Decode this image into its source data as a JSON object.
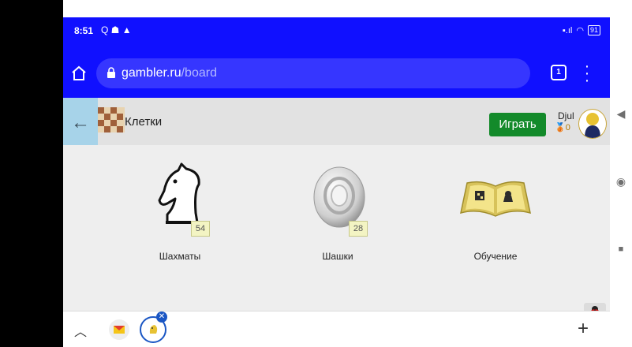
{
  "status_bar": {
    "time": "8:51",
    "left_icons": "Q ☗ ▲",
    "battery": "91"
  },
  "browser": {
    "url_domain": "gambler.ru",
    "url_path": "/board",
    "tab_count": "1"
  },
  "header": {
    "site_name": "Клетки",
    "play_label": "Играть",
    "user_name": "Djul",
    "user_score": "0"
  },
  "games": [
    {
      "label": "Шахматы",
      "count": "54",
      "icon": "chess-knight-icon"
    },
    {
      "label": "Шашки",
      "count": "28",
      "icon": "checker-piece-icon"
    },
    {
      "label": "Обучение",
      "icon": "open-book-icon"
    }
  ],
  "bottom_bar": {
    "add_label": "+"
  },
  "colors": {
    "browser_blue": "#1010ff",
    "play_green": "#138a2a",
    "back_button": "#a7d3e9"
  }
}
